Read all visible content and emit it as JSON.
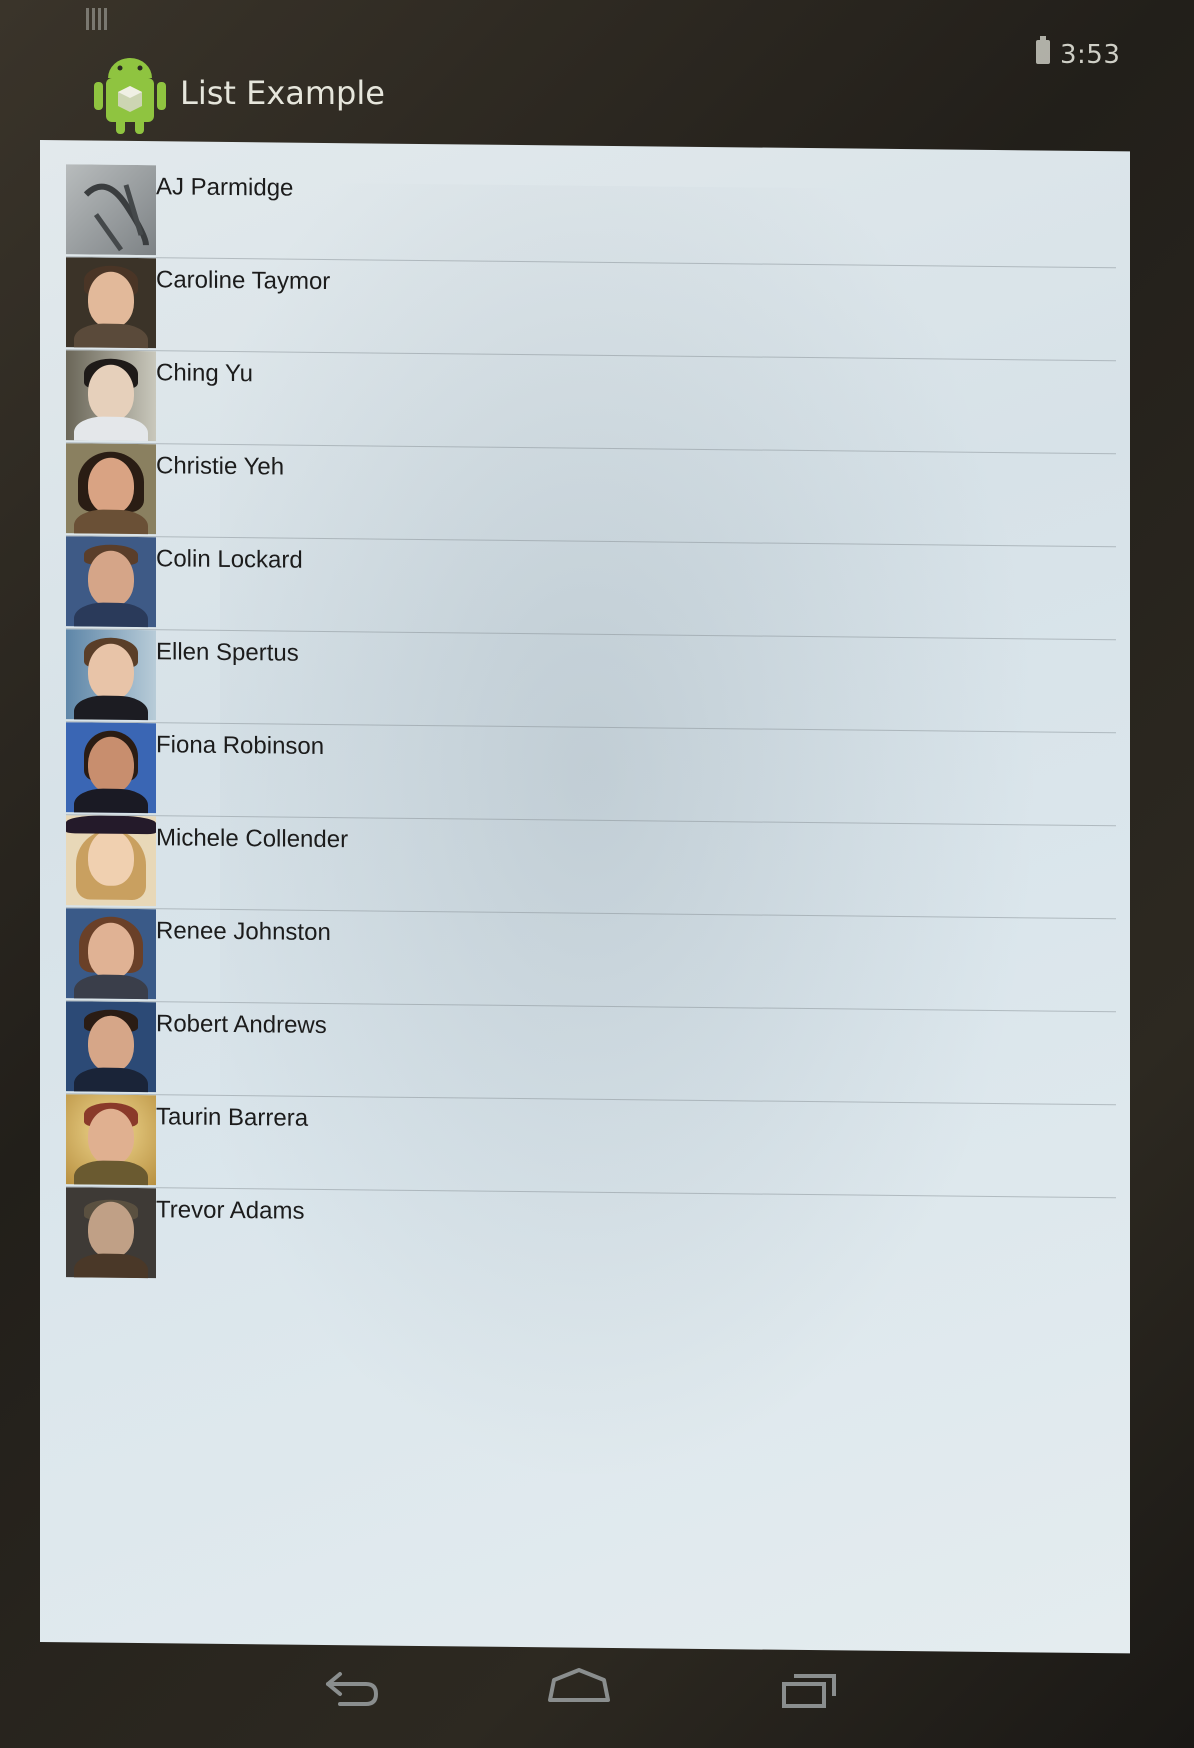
{
  "status_bar": {
    "time": "3:53",
    "icons": [
      "notification-icon",
      "battery-icon"
    ]
  },
  "action_bar": {
    "app_icon": "android-icon",
    "title": "List Example"
  },
  "contacts": [
    {
      "name": "AJ Parmidge"
    },
    {
      "name": "Caroline Taymor"
    },
    {
      "name": "Ching Yu"
    },
    {
      "name": "Christie Yeh"
    },
    {
      "name": "Colin Lockard"
    },
    {
      "name": "Ellen Spertus"
    },
    {
      "name": "Fiona Robinson"
    },
    {
      "name": "Michele Collender"
    },
    {
      "name": "Renee Johnston"
    },
    {
      "name": "Robert Andrews"
    },
    {
      "name": "Taurin Barrera"
    },
    {
      "name": "Trevor Adams"
    }
  ],
  "nav_bar": {
    "icons": [
      "back-icon",
      "home-icon",
      "recent-apps-icon"
    ]
  },
  "colors": {
    "list_background": "#dbe6ec",
    "divider": "#8c969b",
    "name_text": "#1c1c1c",
    "android_green": "#8fc440"
  }
}
